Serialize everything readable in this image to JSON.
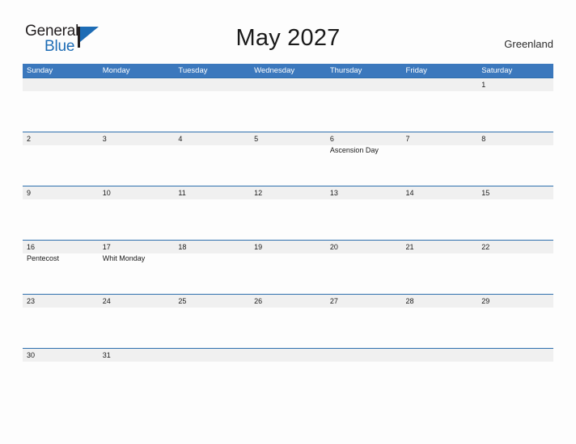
{
  "brand": {
    "name_part1": "General",
    "name_part2": "Blue",
    "flag_color": "#1d6cb5"
  },
  "header": {
    "title": "May 2027",
    "location": "Greenland"
  },
  "calendar": {
    "weekdays": [
      "Sunday",
      "Monday",
      "Tuesday",
      "Wednesday",
      "Thursday",
      "Friday",
      "Saturday"
    ],
    "header_bg": "#3b78bd",
    "row_separator_color": "#2e6fae",
    "daynum_band_bg": "#f0f0f0",
    "weeks": [
      [
        {
          "day": "",
          "event": ""
        },
        {
          "day": "",
          "event": ""
        },
        {
          "day": "",
          "event": ""
        },
        {
          "day": "",
          "event": ""
        },
        {
          "day": "",
          "event": ""
        },
        {
          "day": "",
          "event": ""
        },
        {
          "day": "1",
          "event": ""
        }
      ],
      [
        {
          "day": "2",
          "event": ""
        },
        {
          "day": "3",
          "event": ""
        },
        {
          "day": "4",
          "event": ""
        },
        {
          "day": "5",
          "event": ""
        },
        {
          "day": "6",
          "event": "Ascension Day"
        },
        {
          "day": "7",
          "event": ""
        },
        {
          "day": "8",
          "event": ""
        }
      ],
      [
        {
          "day": "9",
          "event": ""
        },
        {
          "day": "10",
          "event": ""
        },
        {
          "day": "11",
          "event": ""
        },
        {
          "day": "12",
          "event": ""
        },
        {
          "day": "13",
          "event": ""
        },
        {
          "day": "14",
          "event": ""
        },
        {
          "day": "15",
          "event": ""
        }
      ],
      [
        {
          "day": "16",
          "event": "Pentecost"
        },
        {
          "day": "17",
          "event": "Whit Monday"
        },
        {
          "day": "18",
          "event": ""
        },
        {
          "day": "19",
          "event": ""
        },
        {
          "day": "20",
          "event": ""
        },
        {
          "day": "21",
          "event": ""
        },
        {
          "day": "22",
          "event": ""
        }
      ],
      [
        {
          "day": "23",
          "event": ""
        },
        {
          "day": "24",
          "event": ""
        },
        {
          "day": "25",
          "event": ""
        },
        {
          "day": "26",
          "event": ""
        },
        {
          "day": "27",
          "event": ""
        },
        {
          "day": "28",
          "event": ""
        },
        {
          "day": "29",
          "event": ""
        }
      ],
      [
        {
          "day": "30",
          "event": ""
        },
        {
          "day": "31",
          "event": ""
        },
        {
          "day": "",
          "event": ""
        },
        {
          "day": "",
          "event": ""
        },
        {
          "day": "",
          "event": ""
        },
        {
          "day": "",
          "event": ""
        },
        {
          "day": "",
          "event": ""
        }
      ]
    ]
  }
}
